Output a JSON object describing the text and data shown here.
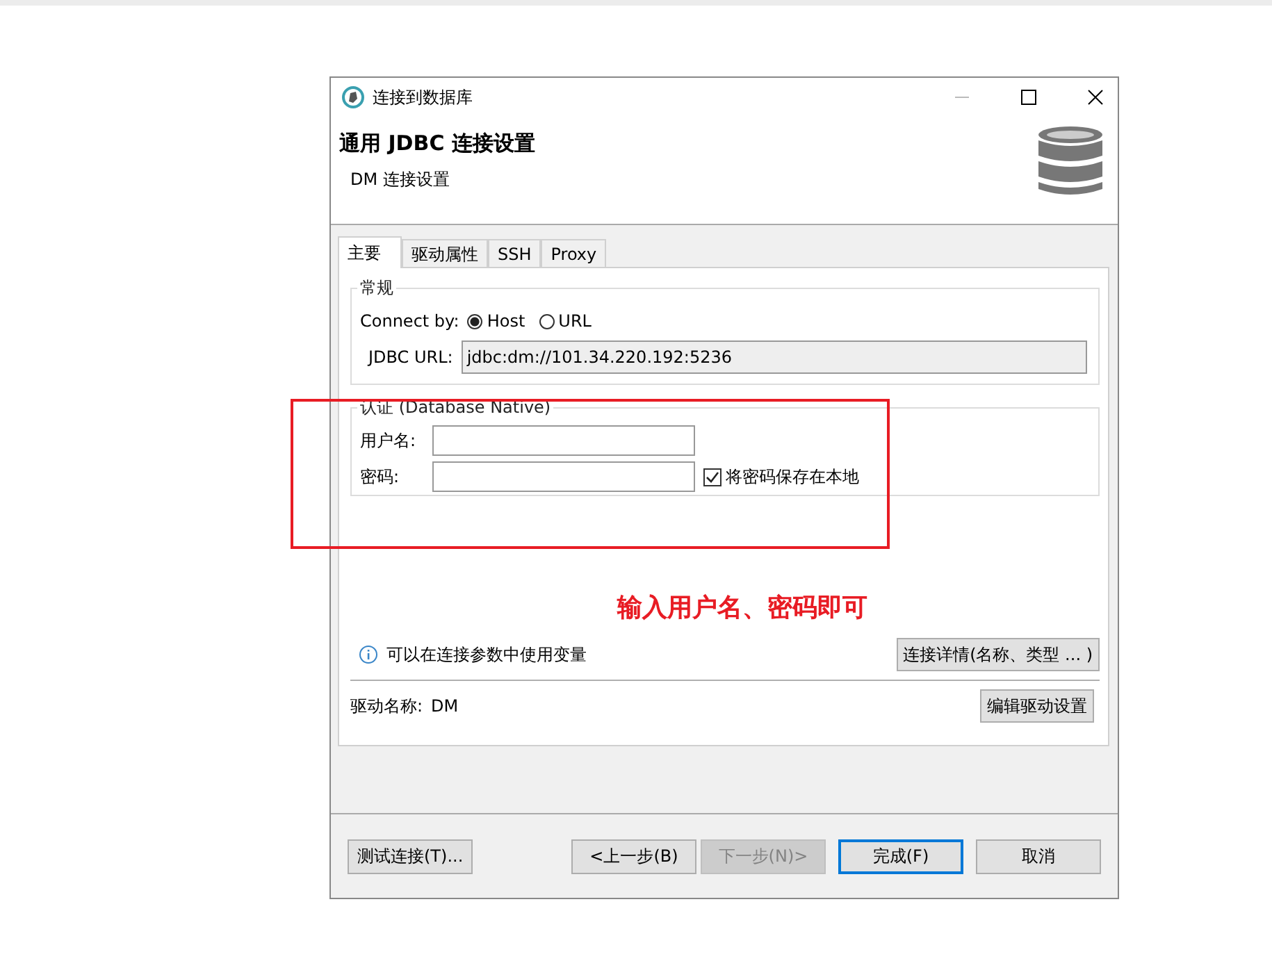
{
  "window": {
    "title": "连接到数据库"
  },
  "header": {
    "title": "通用 JDBC 连接设置",
    "subtitle": "DM 连接设置"
  },
  "tabs": [
    {
      "label": "主要",
      "selected": true
    },
    {
      "label": "驱动属性",
      "selected": false
    },
    {
      "label": "SSH",
      "selected": false
    },
    {
      "label": "Proxy",
      "selected": false
    }
  ],
  "general": {
    "legend": "常规",
    "connect_by_label": "Connect by:",
    "connect_options": [
      {
        "label": "Host",
        "selected": true
      },
      {
        "label": "URL",
        "selected": false
      }
    ],
    "jdbc_url_label": "JDBC URL:",
    "jdbc_url": "jdbc:dm://101.34.220.192:5236"
  },
  "auth": {
    "legend": "认证 (Database Native)",
    "username_label": "用户名:",
    "password_label": "密码:",
    "save_password": {
      "label": "将密码保存在本地",
      "checked": true
    }
  },
  "annotation": "输入用户名、密码即可",
  "info": "可以在连接参数中使用变量",
  "details_button": "连接详情(名称、类型 ... )",
  "driver": {
    "label": "驱动名称:",
    "name": "DM",
    "edit_button": "编辑驱动设置"
  },
  "buttons": [
    {
      "label": "测试连接(T)...",
      "kind": "left",
      "disabled": false,
      "default": false
    },
    {
      "label": "<上一步(B)",
      "kind": "nav",
      "disabled": false,
      "default": false
    },
    {
      "label": "下一步(N)>",
      "kind": "nav",
      "disabled": true,
      "default": false
    },
    {
      "label": "完成(F)",
      "kind": "action",
      "disabled": false,
      "default": true
    },
    {
      "label": "取消",
      "kind": "action",
      "disabled": false,
      "default": false
    }
  ]
}
